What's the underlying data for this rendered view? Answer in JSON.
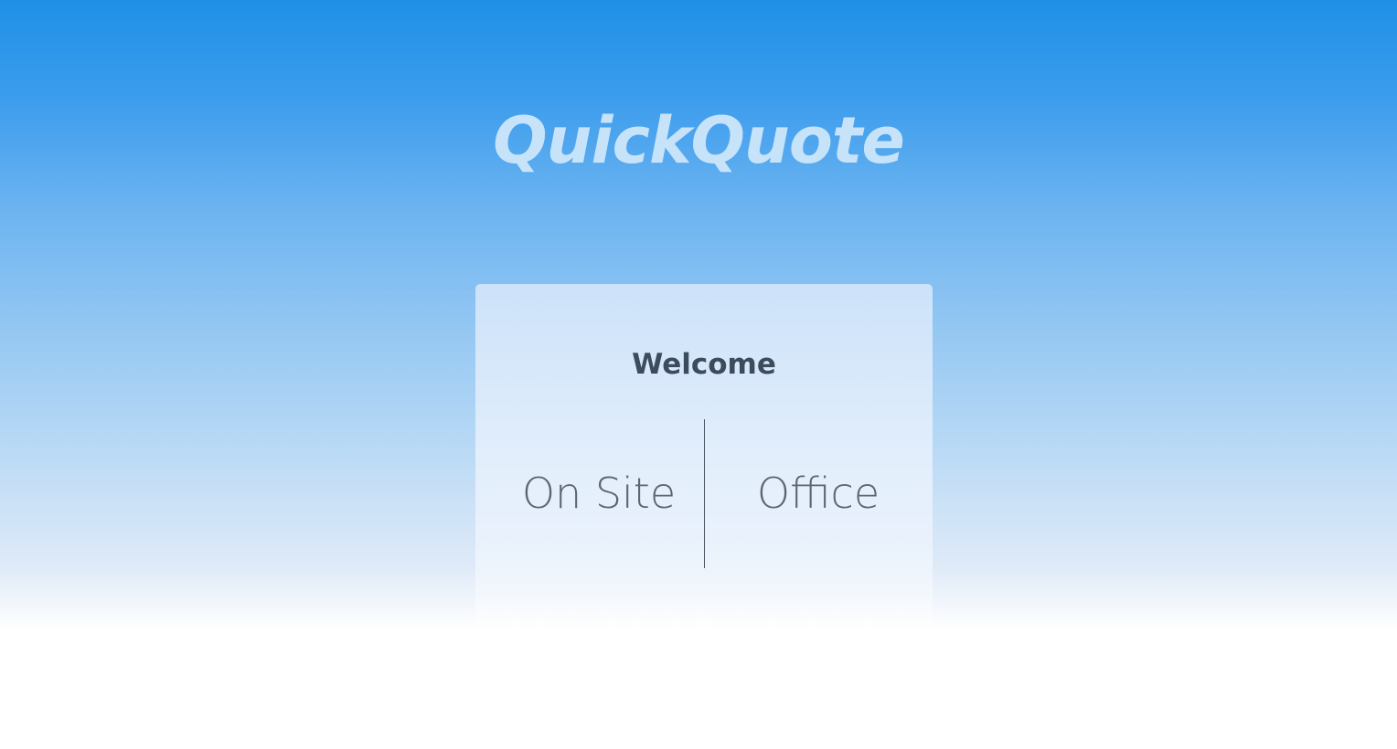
{
  "app": {
    "brand": "QuickQuote"
  },
  "card": {
    "title": "Welcome",
    "options": [
      {
        "label": "On Site"
      },
      {
        "label": "Office"
      }
    ]
  },
  "colors": {
    "gradient_top": "#1e90e6",
    "gradient_bottom": "#ffffff",
    "brand_text": "#c6e3fa",
    "title_text": "#3c4c5c",
    "option_text": "#5d6570"
  }
}
